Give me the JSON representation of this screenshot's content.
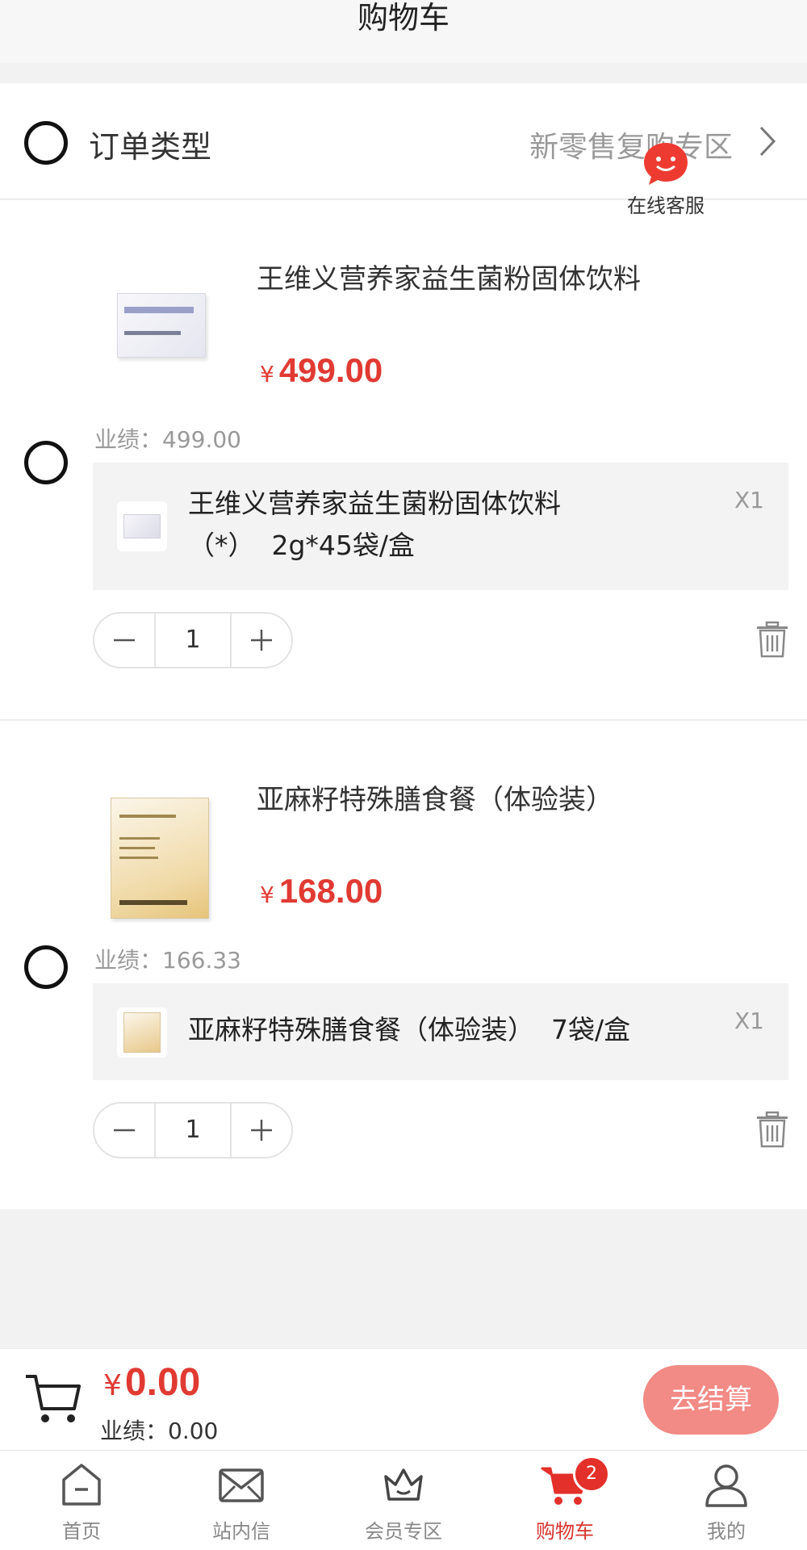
{
  "header": {
    "title": "购物车"
  },
  "order_type": {
    "label": "订单类型",
    "value": "新零售复购专区"
  },
  "service": {
    "label": "在线客服"
  },
  "items": [
    {
      "name": "王维义营养家益生菌粉固体饮料",
      "currency": "¥",
      "price": "499.00",
      "performance": "业绩：499.00",
      "bundle": {
        "name": "王维义营养家益生菌粉固体饮料（*）  2g*45袋/盒",
        "qty": "X1"
      },
      "quantity": "1"
    },
    {
      "name": "亚麻籽特殊膳食餐（体验装）",
      "currency": "¥",
      "price": "168.00",
      "performance": "业绩：166.33",
      "bundle": {
        "name": "亚麻籽特殊膳食餐（体验装）  7袋/盒",
        "qty": "X1"
      },
      "quantity": "1"
    }
  ],
  "checkout": {
    "currency": "¥",
    "total": "0.00",
    "performance": "业绩：0.00",
    "button": "去结算"
  },
  "tabbar": {
    "tabs": [
      {
        "label": "首页",
        "icon": "home-icon"
      },
      {
        "label": "站内信",
        "icon": "mail-icon"
      },
      {
        "label": "会员专区",
        "icon": "crown-icon"
      },
      {
        "label": "购物车",
        "icon": "cart-icon",
        "badge": "2",
        "active": true
      },
      {
        "label": "我的",
        "icon": "user-icon"
      }
    ]
  },
  "colors": {
    "accent": "#e03a33",
    "checkout_button": "#f28a85",
    "background": "#f2f2f2"
  }
}
